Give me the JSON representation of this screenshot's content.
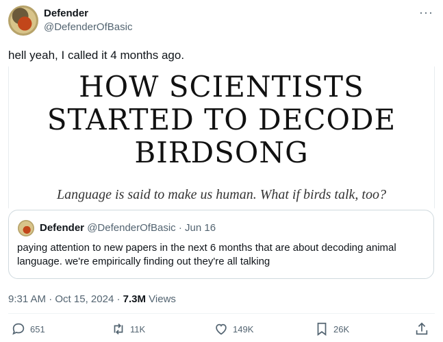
{
  "author": {
    "display_name": "Defender",
    "handle": "@DefenderOfBasic"
  },
  "more_glyph": "···",
  "tweet": {
    "text": "hell yeah, I called it 4 months ago."
  },
  "media": {
    "title_line1": "HOW SCIENTISTS",
    "title_line2": "STARTED TO DECODE",
    "title_line3": "BIRDSONG",
    "subtitle": "Language is said to make us human. What if birds talk, too?"
  },
  "quote": {
    "display_name": "Defender",
    "handle": "@DefenderOfBasic",
    "separator": "·",
    "date": "Jun 16",
    "text": "paying attention to new papers in the next 6 months that are about decoding animal language. we're empirically finding out they're all talking"
  },
  "meta": {
    "time": "9:31 AM",
    "separator": "·",
    "date": "Oct 15, 2024",
    "views_count": "7.3M",
    "views_label": "Views"
  },
  "actions": {
    "replies": "651",
    "reposts": "11K",
    "likes": "149K",
    "bookmarks": "26K"
  },
  "icons": [
    "more-icon",
    "reply-icon",
    "repost-icon",
    "like-icon",
    "bookmark-icon",
    "share-icon"
  ]
}
